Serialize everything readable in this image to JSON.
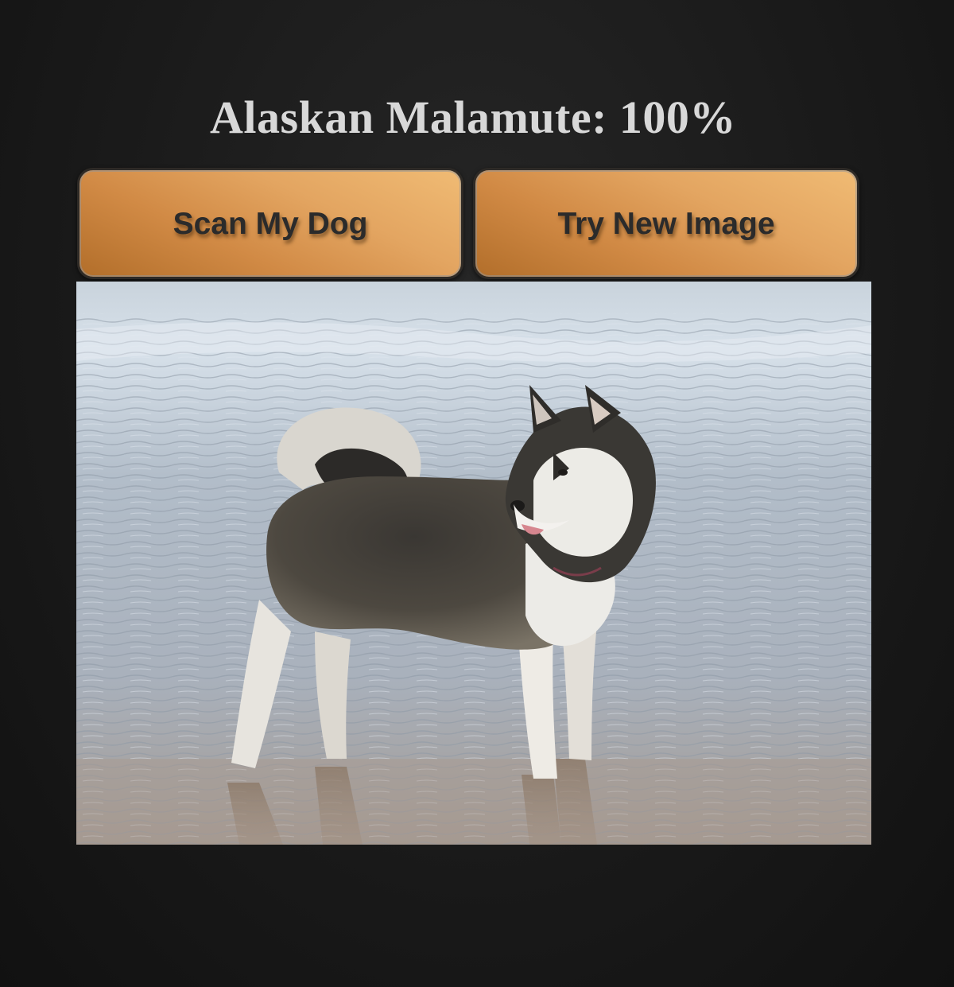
{
  "result": {
    "text": "Alaskan Malamute: 100%"
  },
  "buttons": {
    "scan_label": "Scan My Dog",
    "new_image_label": "Try New Image"
  },
  "photo": {
    "subject": "alaskan-malamute-dog-on-wet-beach"
  },
  "colors": {
    "background": "#161616",
    "title_text": "#d8d8d8",
    "button_gradient_start": "#b26e2a",
    "button_gradient_end": "#f0bb74",
    "button_text": "#2b2b2b"
  }
}
